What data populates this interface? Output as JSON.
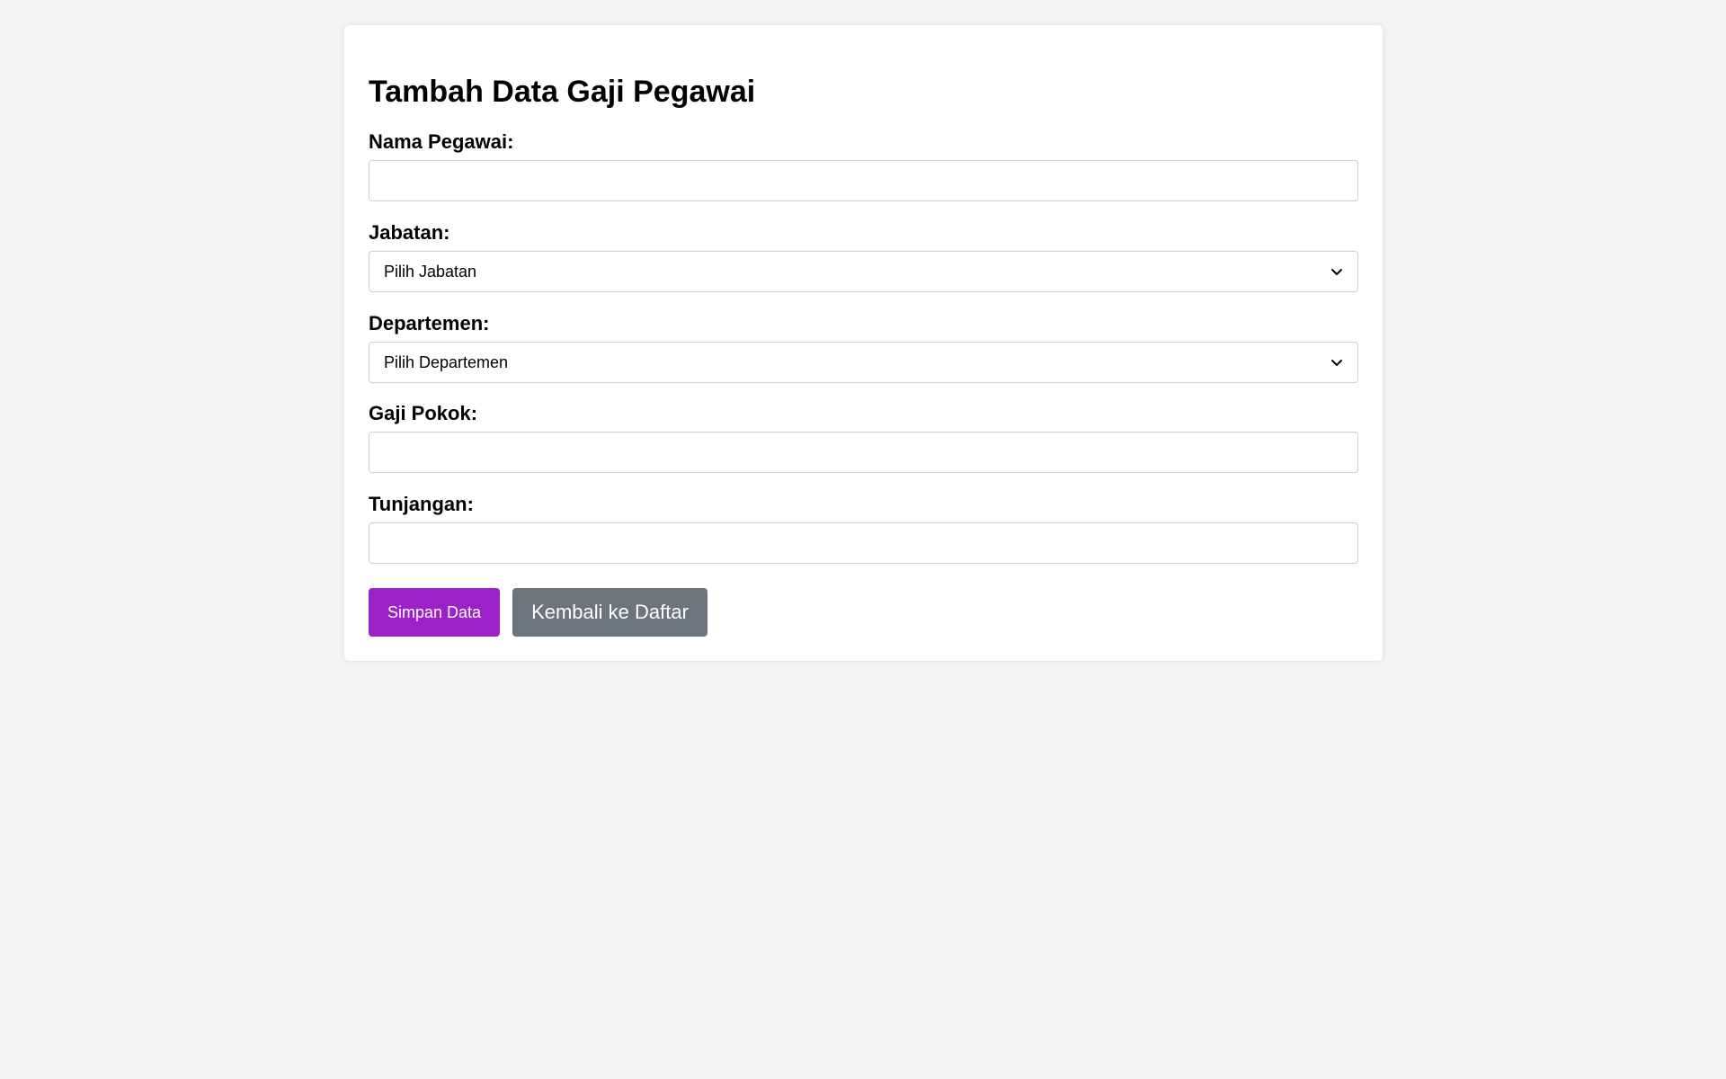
{
  "form": {
    "title": "Tambah Data Gaji Pegawai",
    "fields": {
      "nama_pegawai": {
        "label": "Nama Pegawai:",
        "value": ""
      },
      "jabatan": {
        "label": "Jabatan:",
        "selected": "Pilih Jabatan"
      },
      "departemen": {
        "label": "Departemen:",
        "selected": "Pilih Departemen"
      },
      "gaji_pokok": {
        "label": "Gaji Pokok:",
        "value": ""
      },
      "tunjangan": {
        "label": "Tunjangan:",
        "value": ""
      }
    },
    "buttons": {
      "save_label": "Simpan Data",
      "back_label": "Kembali ke Daftar"
    }
  },
  "colors": {
    "page_background": "#f4f4f4",
    "card_background": "#ffffff",
    "primary_button": "#9b22c9",
    "secondary_button": "#6c757d",
    "input_border": "#cfcfcf"
  },
  "icons": {
    "select_arrow": "chevron-down-icon"
  }
}
